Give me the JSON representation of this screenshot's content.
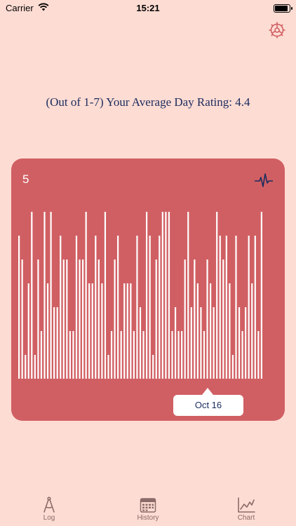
{
  "status_bar": {
    "carrier": "Carrier",
    "time": "15:21"
  },
  "header": {
    "settings_icon": "gear-icon"
  },
  "main": {
    "heading": "(Out of 1-7) Your Average Day Rating: 4.4",
    "chart_value": "5",
    "tooltip": "Oct 16"
  },
  "chart_data": {
    "type": "bar",
    "ylim": [
      0,
      7
    ],
    "grid": false,
    "values": [
      6,
      5,
      1,
      4,
      7,
      1,
      5,
      2,
      7,
      4,
      7,
      3,
      3,
      6,
      5,
      5,
      2,
      2,
      6,
      5,
      5,
      7,
      4,
      4,
      6,
      5,
      4,
      7,
      1,
      2,
      5,
      6,
      2,
      4,
      4,
      4,
      2,
      6,
      3,
      2,
      7,
      6,
      1,
      5,
      6,
      7,
      7,
      7,
      2,
      3,
      2,
      2,
      5,
      7,
      3,
      5,
      4,
      3,
      2,
      5,
      4,
      3,
      7,
      6,
      5,
      6,
      4,
      1,
      6,
      3,
      2,
      3,
      6,
      4,
      6,
      2,
      7
    ]
  },
  "tabs": [
    {
      "label": "Log",
      "icon": "compass-icon"
    },
    {
      "label": "History",
      "icon": "calendar-icon"
    },
    {
      "label": "Chart",
      "icon": "chart-icon"
    }
  ],
  "colors": {
    "background": "#FDDCD3",
    "chart_card": "#D05F63",
    "bar": "#FFFFFF",
    "heading": "#1B2B5E"
  }
}
